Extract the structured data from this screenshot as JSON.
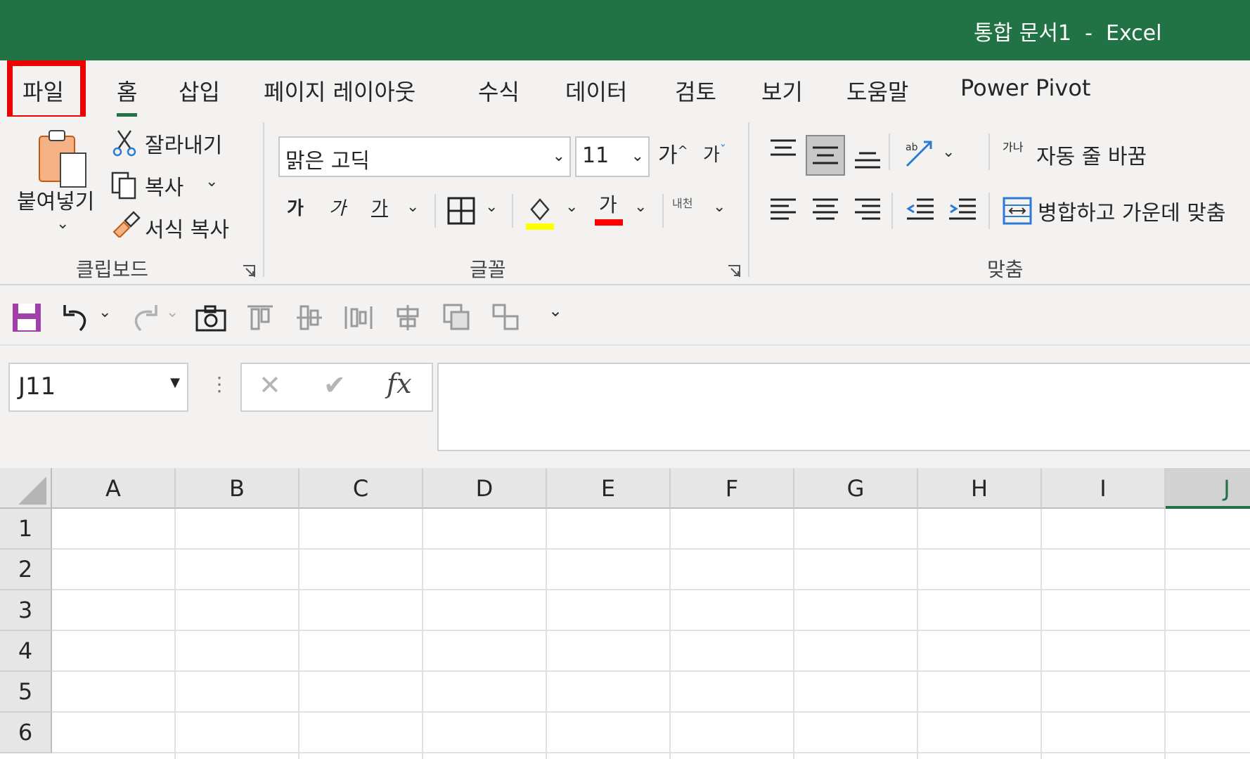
{
  "window": {
    "title": "통합 문서1  -  Excel"
  },
  "tabs": [
    {
      "label": "파일"
    },
    {
      "label": "홈"
    },
    {
      "label": "삽입"
    },
    {
      "label": "페이지 레이아웃"
    },
    {
      "label": "수식"
    },
    {
      "label": "데이터"
    },
    {
      "label": "검토"
    },
    {
      "label": "보기"
    },
    {
      "label": "도움말"
    },
    {
      "label": "Power Pivot"
    }
  ],
  "clipboard": {
    "paste": "붙여넣기",
    "cut": "잘라내기",
    "copy": "복사",
    "format_painter": "서식 복사",
    "group": "클립보드"
  },
  "font": {
    "name": "맑은 고딕",
    "size": "11",
    "grow": "가",
    "shrink": "가",
    "bold": "가",
    "italic": "가",
    "underline": "가",
    "font_color_glyph": "가",
    "phonetic_glyph": "내천",
    "group": "글꼴",
    "highlight_color": "#ffff00",
    "font_color": "#ff0000"
  },
  "alignment": {
    "wrap_text": "자동 줄 바꿈",
    "merge_center": "병합하고 가운데 맞춤",
    "wrap_icon_text": "가나",
    "group": "맞춤"
  },
  "formula_bar": {
    "name_box": "J11",
    "fx": "fx",
    "formula": ""
  },
  "grid": {
    "columns": [
      "A",
      "B",
      "C",
      "D",
      "E",
      "F",
      "G",
      "H",
      "I",
      "J"
    ],
    "rows": [
      "1",
      "2",
      "3",
      "4",
      "5",
      "6"
    ],
    "selected_column": "J"
  },
  "colors": {
    "excel_green": "#217346",
    "highlight_border": "#ee0000"
  }
}
